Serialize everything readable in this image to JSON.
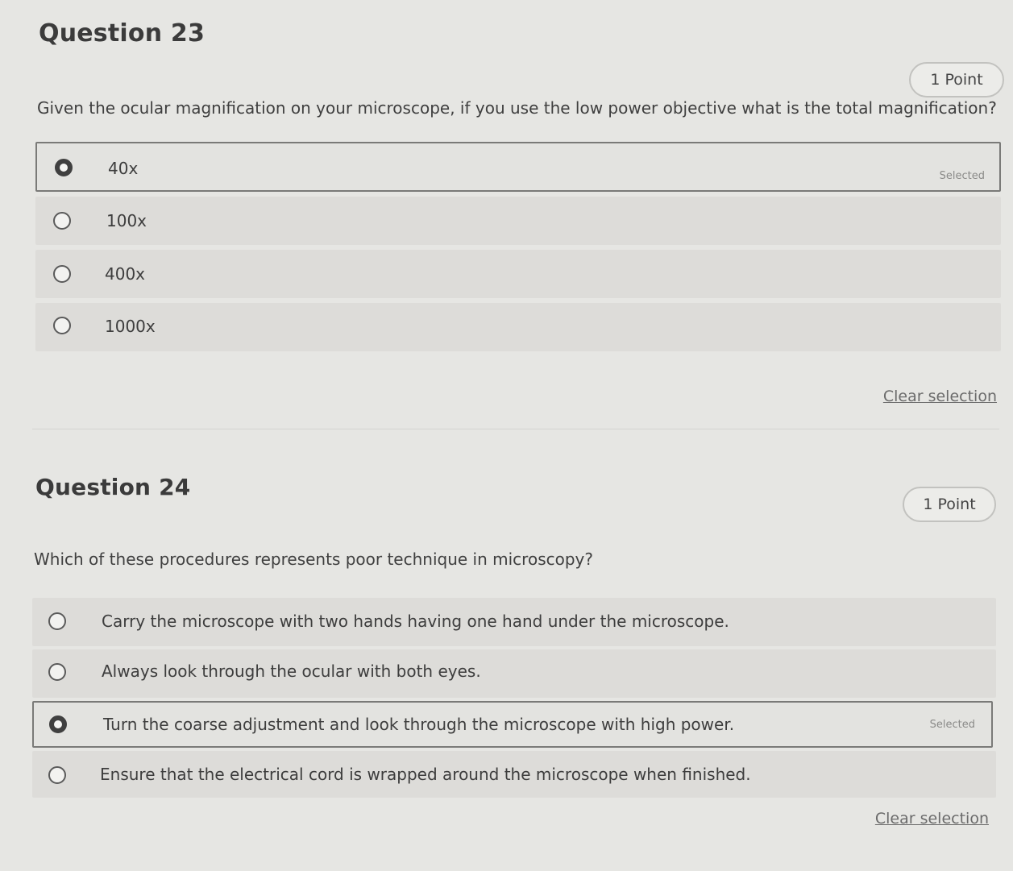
{
  "questions": [
    {
      "title": "Question 23",
      "points": "1 Point",
      "prompt": "Given the ocular magnification on your microscope, if you use the low power objective what is the total magnification?",
      "options": [
        {
          "label": "40x",
          "selected": true
        },
        {
          "label": "100x",
          "selected": false
        },
        {
          "label": "400x",
          "selected": false
        },
        {
          "label": "1000x",
          "selected": false
        }
      ],
      "selected_tag": "Selected",
      "clear_label": "Clear selection"
    },
    {
      "title": "Question 24",
      "points": "1 Point",
      "prompt": "Which of these procedures represents poor technique in microscopy?",
      "options": [
        {
          "label": "Carry the microscope with two hands having one hand under the microscope.",
          "selected": false
        },
        {
          "label": "Always look through the ocular with both eyes.",
          "selected": false
        },
        {
          "label": "Turn the coarse adjustment and look through the microscope with high power.",
          "selected": true
        },
        {
          "label": "Ensure that the electrical cord is wrapped around the microscope when finished.",
          "selected": false
        }
      ],
      "selected_tag": "Selected",
      "clear_label": "Clear selection"
    }
  ]
}
